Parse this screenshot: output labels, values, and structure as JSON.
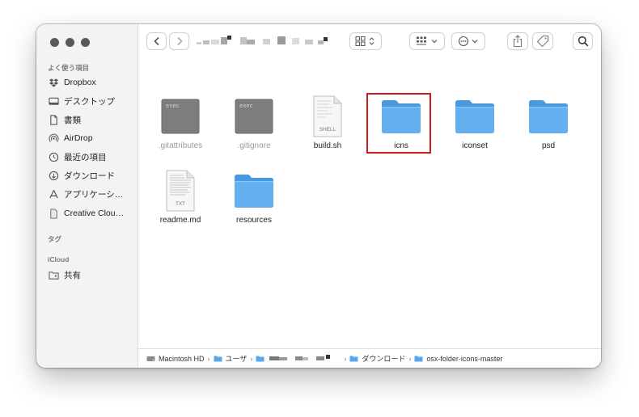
{
  "sidebar": {
    "favorites_header": "よく使う項目",
    "items": [
      {
        "label": "Dropbox",
        "icon": "dropbox-icon"
      },
      {
        "label": "デスクトップ",
        "icon": "desktop-icon"
      },
      {
        "label": "書類",
        "icon": "document-icon"
      },
      {
        "label": "AirDrop",
        "icon": "airdrop-icon"
      },
      {
        "label": "最近の項目",
        "icon": "clock-icon"
      },
      {
        "label": "ダウンロード",
        "icon": "download-icon"
      },
      {
        "label": "アプリケーシ…",
        "icon": "applications-icon"
      },
      {
        "label": "Creative Clou…",
        "icon": "file-icon"
      }
    ],
    "tags_header": "タグ",
    "icloud_header": "iCloud",
    "icloud_items": [
      {
        "label": "共有",
        "icon": "shared-folder-icon"
      }
    ]
  },
  "files": [
    {
      "name": ".gitattributes",
      "kind": "exec",
      "dim": true,
      "badge": "exec"
    },
    {
      "name": ".gitignore",
      "kind": "exec",
      "dim": true,
      "badge": "exec"
    },
    {
      "name": "build.sh",
      "kind": "shell",
      "dim": false,
      "badge": "SHELL"
    },
    {
      "name": "icns",
      "kind": "folder",
      "dim": false,
      "selected": true
    },
    {
      "name": "iconset",
      "kind": "folder",
      "dim": false
    },
    {
      "name": "psd",
      "kind": "folder",
      "dim": false
    },
    {
      "name": "readme.md",
      "kind": "text",
      "dim": false,
      "badge": "TXT"
    },
    {
      "name": "resources",
      "kind": "folder",
      "dim": false
    }
  ],
  "pathbar": {
    "segments": [
      {
        "label": "Macintosh HD",
        "icon": "disk-icon"
      },
      {
        "label": "ユーザ",
        "icon": "folder-icon"
      },
      {
        "label": "",
        "icon": "folder-icon",
        "redacted": true
      },
      {
        "label": "ダウンロード",
        "icon": "folder-icon"
      },
      {
        "label": "osx-folder-icons-master",
        "icon": "folder-icon"
      }
    ],
    "separator": "›"
  },
  "colors": {
    "folder": "#64aff0",
    "selection_frame": "#cc1a1a",
    "sidebar_bg": "#f3f3f3"
  }
}
